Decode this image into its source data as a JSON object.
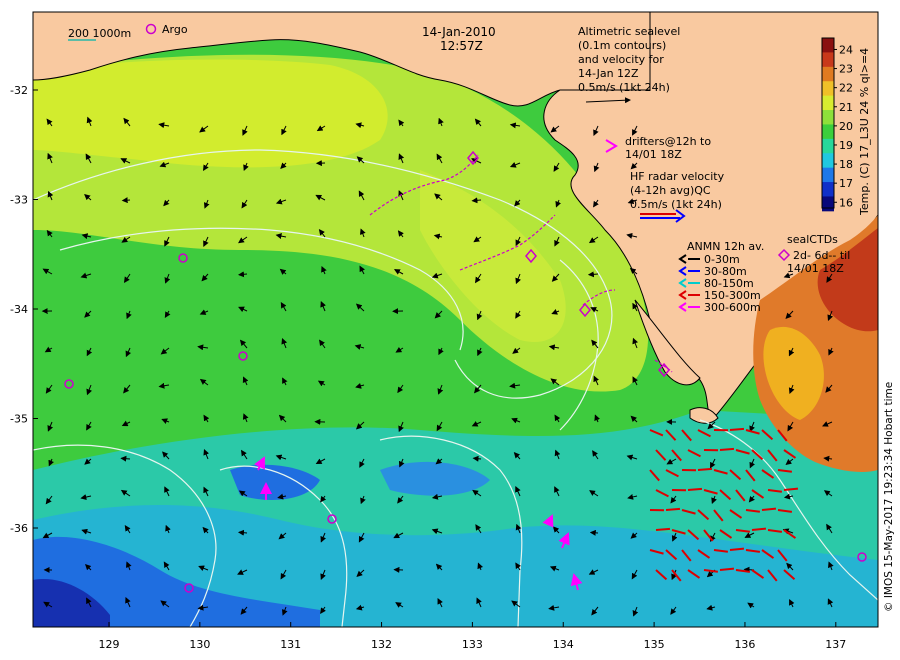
{
  "header": {
    "date": "14-Jan-2010",
    "time": "12:57Z"
  },
  "scale_legend": {
    "label": "200  1000m",
    "argo_label": "Argo"
  },
  "altimetry_note": {
    "lines": [
      "Altimetric sealevel",
      "(0.1m contours)",
      "and velocity for",
      "14-Jan 12Z",
      "0.5m/s (1kt 24h)"
    ]
  },
  "drifters_note": {
    "lines": [
      "drifters@12h to",
      "14/01 18Z"
    ]
  },
  "hf_radar_note": {
    "lines": [
      "HF radar velocity",
      "(4-12h avg)QC",
      "0.5m/s (1kt 24h)"
    ]
  },
  "anmn_legend": {
    "title": "ANMN 12h av.",
    "items": [
      {
        "label": "0-30m",
        "color": "#000000"
      },
      {
        "label": "30-80m",
        "color": "#0000ff"
      },
      {
        "label": "80-150m",
        "color": "#00cccc"
      },
      {
        "label": "150-300m",
        "color": "#dd0000"
      },
      {
        "label": "300-600m",
        "color": "#ff00ff"
      }
    ]
  },
  "seal_legend": {
    "title": "sealCTDs",
    "lines": [
      "2d- 6d-- til",
      "14/01 18Z"
    ]
  },
  "colorbar": {
    "title": "Temp. (C) 17_L3U 24 % ql>=4",
    "ticks": [
      "16",
      "17",
      "18",
      "19",
      "20",
      "21",
      "22",
      "23",
      "24"
    ],
    "min": 15.7,
    "max": 24.6
  },
  "credit": "© IMOS 15-May-2017 19:23:34 Hobart time",
  "axes": {
    "x_ticks": [
      "129",
      "130",
      "131",
      "132",
      "133",
      "134",
      "135",
      "136",
      "137"
    ],
    "y_ticks": [
      "-32",
      "-33",
      "-34",
      "-35",
      "-36"
    ]
  },
  "colors": {
    "land": "#f9c9a0",
    "background": "#ffffff",
    "drifter": "#cc00cc",
    "hf_radar": "#dd0000",
    "contour": "#d8f0e8"
  }
}
